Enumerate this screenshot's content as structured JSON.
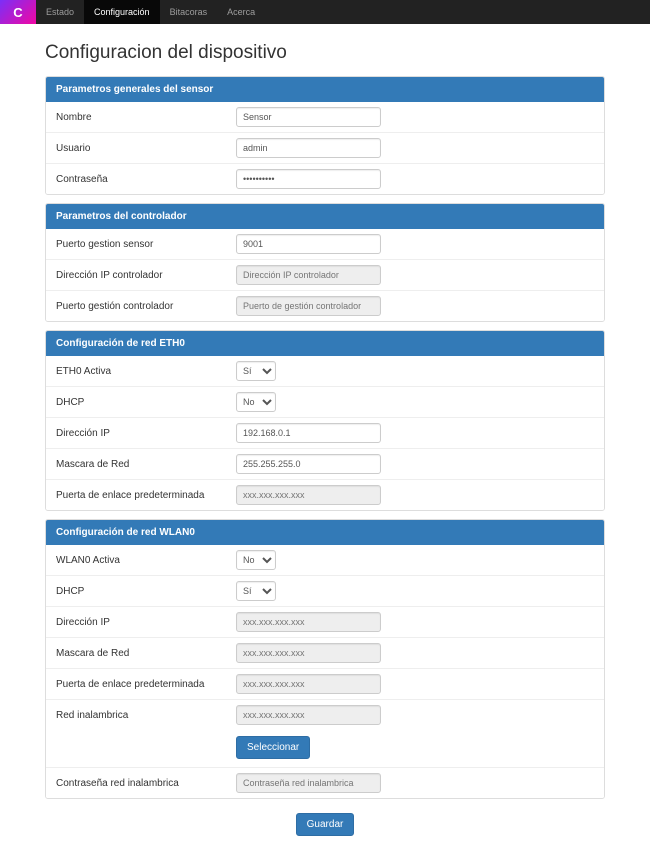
{
  "nav": {
    "items": [
      "Estado",
      "Configuración",
      "Bitacoras",
      "Acerca"
    ],
    "activeIndex": 1
  },
  "page": {
    "title": "Configuracion del dispositivo"
  },
  "sections": {
    "general": {
      "heading": "Parametros generales del sensor",
      "nombre": {
        "label": "Nombre",
        "value": "Sensor"
      },
      "usuario": {
        "label": "Usuario",
        "value": "admin"
      },
      "contrasena": {
        "label": "Contraseña",
        "value": "**********"
      }
    },
    "controller": {
      "heading": "Parametros del controlador",
      "puerto_sensor": {
        "label": "Puerto gestion sensor",
        "value": "9001"
      },
      "ip_ctrl": {
        "label": "Dirección IP controlador",
        "placeholder": "Dirección IP controlador"
      },
      "puerto_ctrl": {
        "label": "Puerto gestión controlador",
        "placeholder": "Puerto de gestión controlador"
      }
    },
    "eth0": {
      "heading": "Configuración de red ETH0",
      "activa": {
        "label": "ETH0 Activa",
        "value": "Sí"
      },
      "dhcp": {
        "label": "DHCP",
        "value": "No"
      },
      "ip": {
        "label": "Dirección IP",
        "value": "192.168.0.1"
      },
      "mask": {
        "label": "Mascara de Red",
        "value": "255.255.255.0"
      },
      "gw": {
        "label": "Puerta de enlace predeterminada",
        "placeholder": "xxx.xxx.xxx.xxx"
      }
    },
    "wlan0": {
      "heading": "Configuración de red WLAN0",
      "activa": {
        "label": "WLAN0 Activa",
        "value": "No"
      },
      "dhcp": {
        "label": "DHCP",
        "value": "Sí"
      },
      "ip": {
        "label": "Dirección IP",
        "placeholder": "xxx.xxx.xxx.xxx"
      },
      "mask": {
        "label": "Mascara de Red",
        "placeholder": "xxx.xxx.xxx.xxx"
      },
      "gw": {
        "label": "Puerta de enlace predeterminada",
        "placeholder": "xxx.xxx.xxx.xxx"
      },
      "ssid": {
        "label": "Red inalambrica",
        "placeholder": "xxx.xxx.xxx.xxx"
      },
      "select_btn": "Seleccionar",
      "pass": {
        "label": "Contraseña red inalambrica",
        "placeholder": "Contraseña red inalambrica"
      }
    }
  },
  "actions": {
    "save": "Guardar"
  },
  "options": {
    "yesno": [
      "Sí",
      "No"
    ]
  }
}
